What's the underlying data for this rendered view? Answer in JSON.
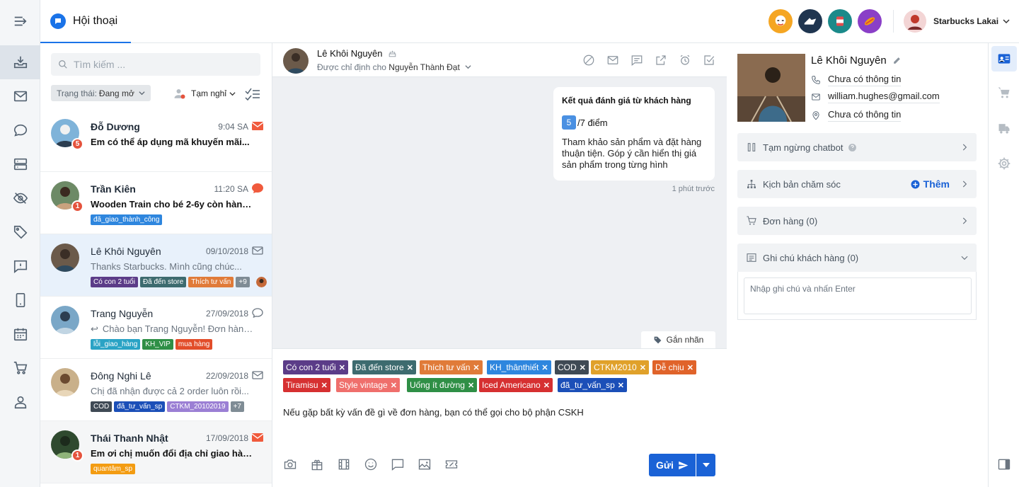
{
  "header": {
    "tab_label": "Hội thoại",
    "user_name": "Starbucks Lakai"
  },
  "list": {
    "search_placeholder": "Tìm kiếm ...",
    "status_label": "Trạng thái:",
    "status_value": "Đang mở",
    "away_label": "Tạm nghỉ",
    "conversations": [
      {
        "name": "Đỗ Dương",
        "time": "9:04 SA",
        "message": "Em có thể áp dụng mã khuyến mãi...",
        "badge": "5",
        "unread": true,
        "tags": []
      },
      {
        "name": "Trần Kiên",
        "time": "11:20 SA",
        "message": "Wooden Train cho bé 2-6y còn hàng...",
        "badge": "1",
        "unread": true,
        "tags": [
          {
            "label": "đã_giao_thành_công",
            "color": "#2e86de"
          }
        ]
      },
      {
        "name": "Lê Khôi Nguyên",
        "time": "09/10/2018",
        "message": "Thanks Starbucks. Mình cũng chúc...",
        "badge": "",
        "unread": false,
        "tags": [
          {
            "label": "Có con 2 tuổi",
            "color": "#5b3c88"
          },
          {
            "label": "Đã đến store",
            "color": "#3d6b6f"
          },
          {
            "label": "Thích tư vấn",
            "color": "#e07b39"
          },
          {
            "label": "+9",
            "color": "#7f8c95"
          }
        ]
      },
      {
        "name": "Trang Nguyễn",
        "time": "27/09/2018",
        "message": "Chào bạn Trang Nguyễn! Đơn hàng...",
        "badge": "",
        "unread": false,
        "tags": [
          {
            "label": "lỗi_giao_hàng",
            "color": "#2aa3c5"
          },
          {
            "label": "KH_VIP",
            "color": "#2f8f46"
          },
          {
            "label": "mua hàng",
            "color": "#e24d2a"
          }
        ]
      },
      {
        "name": "Đông Nghi Lê",
        "time": "22/09/2018",
        "message": "Chị đã nhận được cả 2 order luôn rồi...",
        "badge": "",
        "unread": false,
        "tags": [
          {
            "label": "COD",
            "color": "#3f4a55"
          },
          {
            "label": "đã_tư_vấn_sp",
            "color": "#1b4fb8"
          },
          {
            "label": "CTKM_20102019",
            "color": "#9b7fd4"
          },
          {
            "label": "+7",
            "color": "#7f8c95"
          }
        ]
      },
      {
        "name": "Thái Thanh Nhật",
        "time": "17/09/2018",
        "message": "Em ơi chị muốn đổi địa chỉ giao hàng...",
        "badge": "1",
        "unread": true,
        "tags": [
          {
            "label": "quantâm_sp",
            "color": "#f39c12"
          }
        ]
      }
    ]
  },
  "chat": {
    "contact_name": "Lê Khôi Nguyên",
    "assigned_prefix": "Được chỉ định cho",
    "assigned_to": "Nguyễn Thành Đạt",
    "bubble_title": "Kết quả đánh giá từ khách hàng",
    "score": "5",
    "score_suffix": "/7 điểm",
    "bubble_text": "Tham khảo sản phẩm và đặt hàng thuận tiện. Góp ý cần hiển thị giá sản phẩm trong từng hình",
    "time_ago": "1 phút trước",
    "label_tab": "Gắn nhãn",
    "tags": [
      {
        "label": "Có con 2 tuổi",
        "color": "#5b3c88"
      },
      {
        "label": "Đã đến store",
        "color": "#3d6b6f"
      },
      {
        "label": "Thích tư vấn",
        "color": "#e07b39"
      },
      {
        "label": "KH_thânthiết",
        "color": "#2e86de"
      },
      {
        "label": "COD",
        "color": "#3f4a55"
      },
      {
        "label": "CTKM2010",
        "color": "#e0a12a"
      },
      {
        "label": "Dễ chịu",
        "color": "#e0632a"
      },
      {
        "label": "Tiramisu",
        "color": "#d63031"
      },
      {
        "label": "Style vintage",
        "color": "#ef6f6c"
      },
      {
        "label": "Uống ít đường",
        "color": "#2f8f46"
      },
      {
        "label": "Iced Americano",
        "color": "#d63031"
      },
      {
        "label": "đã_tư_vấn_sp",
        "color": "#1b4fb8"
      }
    ],
    "composer_text": "Nếu gặp bất kỳ vấn đề gì về đơn hàng, bạn có thể gọi cho bộ phận CSKH",
    "send_label": "Gửi"
  },
  "customer": {
    "name": "Lê Khôi Nguyên",
    "phone": "Chưa có thông tin",
    "email": "william.hughes@gmail.com",
    "address": "Chưa có thông tin",
    "chatbot_label": "Tạm ngừng chatbot",
    "care_label": "Kịch bản chăm sóc",
    "care_add": "Thêm",
    "orders_label": "Đơn hàng (0)",
    "notes_label": "Ghi chú khách hàng (0)",
    "notes_placeholder": "Nhập ghi chú và nhấn Enter"
  },
  "colors": {
    "accent": "#1a73e8",
    "send": "#1a62d6",
    "unread_badge": "#e5533d"
  }
}
